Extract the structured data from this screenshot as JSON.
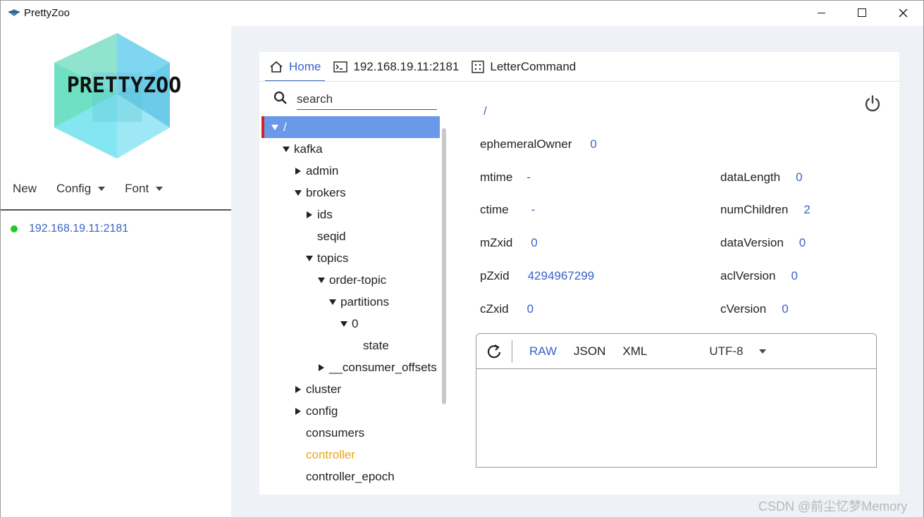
{
  "window": {
    "title": "PrettyZoo"
  },
  "left_panel": {
    "logo_text": "PRETTYZOO",
    "menu": [
      {
        "label": "New"
      },
      {
        "label": "Config"
      },
      {
        "label": "Font"
      }
    ],
    "servers": [
      {
        "label": "192.168.19.11:2181",
        "status_color": "#22cc22"
      }
    ]
  },
  "tabs": [
    {
      "label": "Home",
      "icon": "home-icon",
      "active": true
    },
    {
      "label": "192.168.19.11:2181",
      "icon": "terminal-icon",
      "active": false
    },
    {
      "label": "LetterCommand",
      "icon": "grid-icon",
      "active": false
    }
  ],
  "search": {
    "placeholder": "search"
  },
  "tree": [
    {
      "label": "/",
      "state": "expanded",
      "selected": true
    },
    {
      "label": "kafka",
      "state": "expanded"
    },
    {
      "label": "admin",
      "state": "collapsed"
    },
    {
      "label": "brokers",
      "state": "expanded"
    },
    {
      "label": "ids",
      "state": "collapsed"
    },
    {
      "label": "seqid",
      "state": "leaf"
    },
    {
      "label": "topics",
      "state": "expanded"
    },
    {
      "label": "order-topic",
      "state": "expanded"
    },
    {
      "label": "partitions",
      "state": "expanded"
    },
    {
      "label": "0",
      "state": "expanded"
    },
    {
      "label": "state",
      "state": "leaf"
    },
    {
      "label": "__consumer_offsets",
      "state": "collapsed"
    },
    {
      "label": "cluster",
      "state": "collapsed"
    },
    {
      "label": "config",
      "state": "collapsed"
    },
    {
      "label": "consumers",
      "state": "leaf"
    },
    {
      "label": "controller",
      "state": "leaf",
      "highlight_color": "#e6a817"
    },
    {
      "label": "controller_epoch",
      "state": "leaf"
    }
  ],
  "node": {
    "path": "/",
    "ephemeralOwner": {
      "label": "ephemeralOwner",
      "value": "0"
    },
    "mtime": {
      "label": "mtime",
      "value": "-"
    },
    "ctime": {
      "label": "ctime",
      "value": "-"
    },
    "mZxid": {
      "label": "mZxid",
      "value": "0"
    },
    "pZxid": {
      "label": "pZxid",
      "value": "4294967299"
    },
    "cZxid": {
      "label": "cZxid",
      "value": "0"
    },
    "dataLength": {
      "label": "dataLength",
      "value": "0"
    },
    "numChildren": {
      "label": "numChildren",
      "value": "2"
    },
    "dataVersion": {
      "label": "dataVersion",
      "value": "0"
    },
    "aclVersion": {
      "label": "aclVersion",
      "value": "0"
    },
    "cVersion": {
      "label": "cVersion",
      "value": "0"
    }
  },
  "data_viewer": {
    "formats": [
      "RAW",
      "JSON",
      "XML"
    ],
    "active_format": "RAW",
    "encoding": "UTF-8",
    "content": ""
  },
  "watermark": "CSDN @前尘忆梦Memory",
  "colors": {
    "accent": "#3a63c7",
    "selected_row": "#6a99ea",
    "selected_marker": "#d92020",
    "connected": "#22cc22"
  }
}
